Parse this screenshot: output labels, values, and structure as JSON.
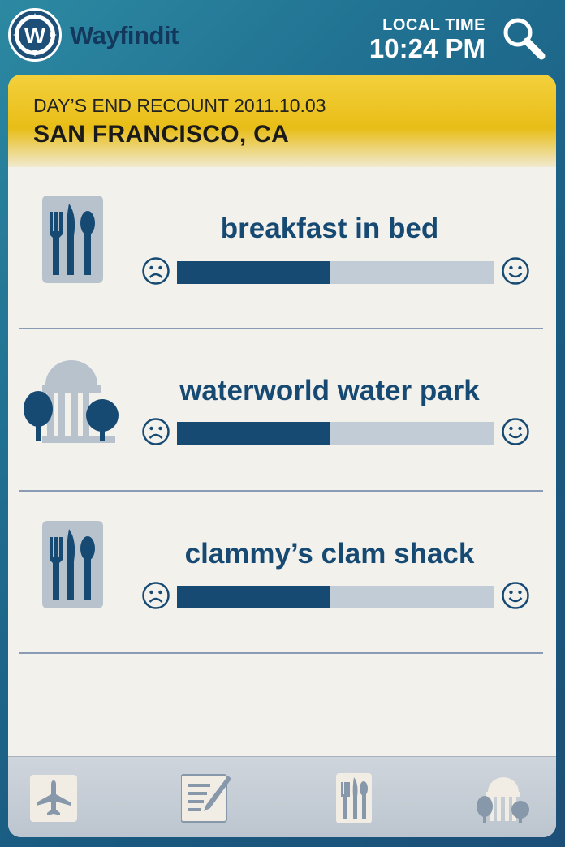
{
  "app": {
    "name": "Wayfindit"
  },
  "clock": {
    "label": "LOCAL TIME",
    "value": "10:24 PM"
  },
  "header": {
    "recount": "DAY’S END RECOUNT 2011.10.03",
    "city": "SAN FRANCISCO, CA"
  },
  "items": [
    {
      "title": "breakfast in bed",
      "category_icon": "restaurant-icon",
      "rating": 0.48
    },
    {
      "title": "waterworld water park",
      "category_icon": "park-icon",
      "rating": 0.48
    },
    {
      "title": "clammy’s clam shack",
      "category_icon": "restaurant-icon",
      "rating": 0.48
    }
  ],
  "tabs": [
    {
      "icon": "airplane-icon"
    },
    {
      "icon": "notes-icon"
    },
    {
      "icon": "restaurant-icon"
    },
    {
      "icon": "park-icon"
    }
  ],
  "colors": {
    "accent": "#174a73",
    "header_yellow": "#e8bd17",
    "track": "#c2ccd6",
    "card": "#f3f1ec"
  }
}
